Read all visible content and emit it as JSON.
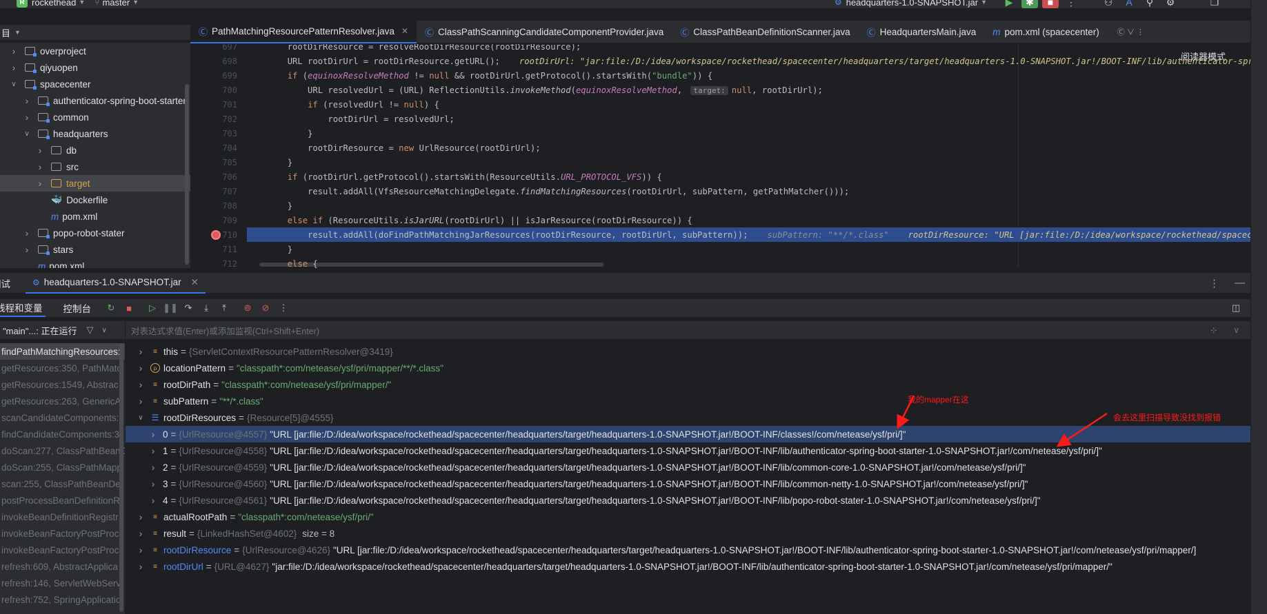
{
  "toolbar": {
    "project_badge": "R",
    "project_name": "rockethead",
    "branch": "master",
    "run_config": "headquarters-1.0-SNAPSHOT.jar"
  },
  "project_panel": {
    "title": "目",
    "tree": [
      {
        "label": "overproject",
        "indent": 0,
        "expanded": false,
        "type": "module"
      },
      {
        "label": "qiyuopen",
        "indent": 0,
        "expanded": false,
        "type": "module"
      },
      {
        "label": "spacecenter",
        "indent": 0,
        "expanded": true,
        "type": "module"
      },
      {
        "label": "authenticator-spring-boot-starter",
        "indent": 1,
        "expanded": false,
        "type": "module"
      },
      {
        "label": "common",
        "indent": 1,
        "expanded": false,
        "type": "module"
      },
      {
        "label": "headquarters",
        "indent": 1,
        "expanded": true,
        "type": "module"
      },
      {
        "label": "db",
        "indent": 2,
        "expanded": false,
        "type": "folder"
      },
      {
        "label": "src",
        "indent": 2,
        "expanded": false,
        "type": "folder"
      },
      {
        "label": "target",
        "indent": 2,
        "expanded": false,
        "type": "folder-excluded",
        "selected": true
      },
      {
        "label": "Dockerfile",
        "indent": 2,
        "expanded": null,
        "type": "docker"
      },
      {
        "label": "pom.xml",
        "indent": 2,
        "expanded": null,
        "type": "maven"
      },
      {
        "label": "popo-robot-stater",
        "indent": 1,
        "expanded": false,
        "type": "module"
      },
      {
        "label": "stars",
        "indent": 1,
        "expanded": false,
        "type": "module"
      },
      {
        "label": "pom.xml",
        "indent": 1,
        "expanded": null,
        "type": "maven"
      }
    ]
  },
  "editor": {
    "tabs": [
      {
        "label": "PathMatchingResourcePatternResolver.java",
        "active": true,
        "closable": true,
        "kind": "class"
      },
      {
        "label": "ClassPathScanningCandidateComponentProvider.java",
        "active": false,
        "kind": "class"
      },
      {
        "label": "ClassPathBeanDefinitionScanner.java",
        "active": false,
        "kind": "class"
      },
      {
        "label": "HeadquartersMain.java",
        "active": false,
        "kind": "class"
      },
      {
        "label": "pom.xml (spacecenter)",
        "active": false,
        "kind": "maven"
      }
    ],
    "reader_mode": "阅读器模式",
    "lines": [
      {
        "n": "697",
        "html": "        rootDirResource = resolveRootDirResource(rootDirResource);"
      },
      {
        "n": "698",
        "html": "        URL rootDirUrl = rootDirResource.getURL();"
      },
      {
        "n": "699",
        "html": "        if (equinoxResolveMethod != null && rootDirUrl.getProtocol().startsWith(\"bundle\")) {"
      },
      {
        "n": "700",
        "html": "            URL resolvedUrl = (URL) ReflectionUtils.invokeMethod(equinoxResolveMethod, target: null, rootDirUrl);"
      },
      {
        "n": "701",
        "html": "            if (resolvedUrl != null) {"
      },
      {
        "n": "702",
        "html": "                rootDirUrl = resolvedUrl;"
      },
      {
        "n": "703",
        "html": "            }"
      },
      {
        "n": "704",
        "html": "            rootDirResource = new UrlResource(rootDirUrl);"
      },
      {
        "n": "705",
        "html": "        }"
      },
      {
        "n": "706",
        "html": "        if (rootDirUrl.getProtocol().startsWith(ResourceUtils.URL_PROTOCOL_VFS)) {"
      },
      {
        "n": "707",
        "html": "            result.addAll(VfsResourceMatchingDelegate.findMatchingResources(rootDirUrl, subPattern, getPathMatcher()));"
      },
      {
        "n": "708",
        "html": "        }"
      },
      {
        "n": "709",
        "html": "        else if (ResourceUtils.isJarURL(rootDirUrl) || isJarResource(rootDirResource)) {"
      },
      {
        "n": "710",
        "html": "            result.addAll(doFindPathMatchingJarResources(rootDirResource, rootDirUrl, subPattern));"
      },
      {
        "n": "711",
        "html": "        }"
      },
      {
        "n": "712",
        "html": "        else {"
      }
    ],
    "inline_698": "rootDirUrl: \"jar:file:/D:/idea/workspace/rockethead/spacecenter/headquarters/target/headquarters-1.0-SNAPSHOT.jar!/BOOT-INF/lib/authenticator-spring-boot",
    "inline_710_a": "subPattern: \"**/*.class\"",
    "inline_710_b": "rootDirResource: \"URL [jar:file:/D:/idea/workspace/rockethead/spacecenter/h"
  },
  "debug": {
    "title": "调试",
    "session_tab": "headquarters-1.0-SNAPSHOT.jar",
    "sub_tabs": [
      "线程和变量",
      "控制台"
    ],
    "thread": "\"main\"...: 正在运行",
    "watch_placeholder": "对表达式求值(Enter)或添加监视(Ctrl+Shift+Enter)",
    "frames": [
      "findPathMatchingResources:",
      "getResources:350, PathMatc",
      "getResources:1549, Abstrac",
      "getResources:263, GenericA",
      "scanCandidateComponents:",
      "findCandidateComponents:3",
      "doScan:277, ClassPathBeanD",
      "doScan:255, ClassPathMapp",
      "scan:255, ClassPathBeanDef",
      "postProcessBeanDefinitionR",
      "invokeBeanDefinitionRegistr",
      "invokeBeanFactoryPostProce",
      "invokeBeanFactoryPostProce",
      "refresh:609, AbstractApplica",
      "refresh:146, ServletWebServ",
      "refresh:752, SpringApplicatio"
    ],
    "variables": [
      {
        "level": 0,
        "icon": "field",
        "name": "this",
        "eq": " = ",
        "ref": "{ServletContextResourcePatternResolver@3419}",
        "value": "",
        "size": "",
        "expandable": true
      },
      {
        "level": 0,
        "icon": "param",
        "name": "locationPattern",
        "eq": " = ",
        "ref": "",
        "str": "\"classpath*:com/netease/ysf/pri/mapper/**/*.class\"",
        "expandable": true
      },
      {
        "level": 0,
        "icon": "field",
        "name": "rootDirPath",
        "eq": " = ",
        "ref": "",
        "str": "\"classpath*:com/netease/ysf/pri/mapper/\"",
        "expandable": true
      },
      {
        "level": 0,
        "icon": "field",
        "name": "subPattern",
        "eq": " = ",
        "ref": "",
        "str": "\"**/*.class\"",
        "expandable": true
      },
      {
        "level": 0,
        "icon": "array",
        "name": "rootDirResources",
        "eq": " = ",
        "ref": "{Resource[5]@4555}",
        "expanded": true
      },
      {
        "level": 1,
        "icon": "none",
        "name": "0",
        "eq": " = ",
        "ref": "{UrlResource@4557}",
        "value": "\"URL [jar:file:/D:/idea/workspace/rockethead/spacecenter/headquarters/target/headquarters-1.0-SNAPSHOT.jar!/BOOT-INF/classes!/com/netease/ysf/pri/]\"",
        "selected": true
      },
      {
        "level": 1,
        "icon": "none",
        "name": "1",
        "eq": " = ",
        "ref": "{UrlResource@4558}",
        "value": "\"URL [jar:file:/D:/idea/workspace/rockethead/spacecenter/headquarters/target/headquarters-1.0-SNAPSHOT.jar!/BOOT-INF/lib/authenticator-spring-boot-starter-1.0-SNAPSHOT.jar!/com/netease/ysf/pri/]\""
      },
      {
        "level": 1,
        "icon": "none",
        "name": "2",
        "eq": " = ",
        "ref": "{UrlResource@4559}",
        "value": "\"URL [jar:file:/D:/idea/workspace/rockethead/spacecenter/headquarters/target/headquarters-1.0-SNAPSHOT.jar!/BOOT-INF/lib/common-core-1.0-SNAPSHOT.jar!/com/netease/ysf/pri/]\""
      },
      {
        "level": 1,
        "icon": "none",
        "name": "3",
        "eq": " = ",
        "ref": "{UrlResource@4560}",
        "value": "\"URL [jar:file:/D:/idea/workspace/rockethead/spacecenter/headquarters/target/headquarters-1.0-SNAPSHOT.jar!/BOOT-INF/lib/common-netty-1.0-SNAPSHOT.jar!/com/netease/ysf/pri/]\""
      },
      {
        "level": 1,
        "icon": "none",
        "name": "4",
        "eq": " = ",
        "ref": "{UrlResource@4561}",
        "value": "\"URL [jar:file:/D:/idea/workspace/rockethead/spacecenter/headquarters/target/headquarters-1.0-SNAPSHOT.jar!/BOOT-INF/lib/popo-robot-stater-1.0-SNAPSHOT.jar!/com/netease/ysf/pri/]\""
      },
      {
        "level": 0,
        "icon": "field",
        "name": "actualRootPath",
        "eq": " = ",
        "ref": "",
        "str": "\"classpath*:com/netease/ysf/pri/\"",
        "expandable": true
      },
      {
        "level": 0,
        "icon": "field",
        "name": "result",
        "eq": " = ",
        "ref": "{LinkedHashSet@4602}",
        "size": "size = 8",
        "expandable": true
      },
      {
        "level": 0,
        "icon": "field",
        "name": "rootDirResource",
        "blue": true,
        "eq": " = ",
        "ref": "{UrlResource@4626}",
        "value": "\"URL [jar:file:/D:/idea/workspace/rockethead/spacecenter/headquarters/target/headquarters-1.0-SNAPSHOT.jar!/BOOT-INF/lib/authenticator-spring-boot-starter-1.0-SNAPSHOT.jar!/com/netease/ysf/pri/mapper/]",
        "expandable": true
      },
      {
        "level": 0,
        "icon": "field",
        "name": "rootDirUrl",
        "blue": true,
        "eq": " = ",
        "ref": "{URL@4627}",
        "value": "\"jar:file:/D:/idea/workspace/rockethead/spacecenter/headquarters/target/headquarters-1.0-SNAPSHOT.jar!/BOOT-INF/lib/authenticator-spring-boot-starter-1.0-SNAPSHOT.jar!/com/netease/ysf/pri/mapper/\"",
        "expandable": true
      }
    ]
  },
  "annotations": {
    "note_1": "我的mapper在这",
    "note_2": "会去这里扫描导致没找到报错",
    "color": "#ff1a1a"
  },
  "colors": {
    "accent": "#3574f0",
    "selection": "#2d4d8f",
    "breakpoint": "#db5c5c"
  }
}
